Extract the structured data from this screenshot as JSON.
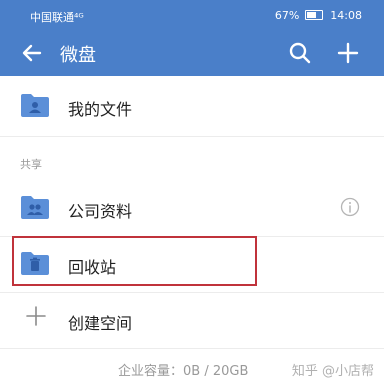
{
  "status_bar": {
    "carrier": "中国联通⁴ᴳ",
    "battery": "67%",
    "time": "14:08"
  },
  "app_bar": {
    "title": "微盘",
    "back_icon": "back-arrow-icon",
    "search_icon": "search-icon",
    "add_icon": "plus-icon"
  },
  "items": {
    "my_files": "我的文件",
    "shared_header": "共享",
    "company_files": "公司资料",
    "recycle_bin": "回收站",
    "create_space": "创建空间"
  },
  "footer": {
    "capacity": "企业容量：0B / 20GB",
    "watermark": "知乎 @小店帮"
  },
  "colors": {
    "primary": "#4a7fc9",
    "folder": "#5b8fd8",
    "highlight_border": "#c0333b"
  }
}
